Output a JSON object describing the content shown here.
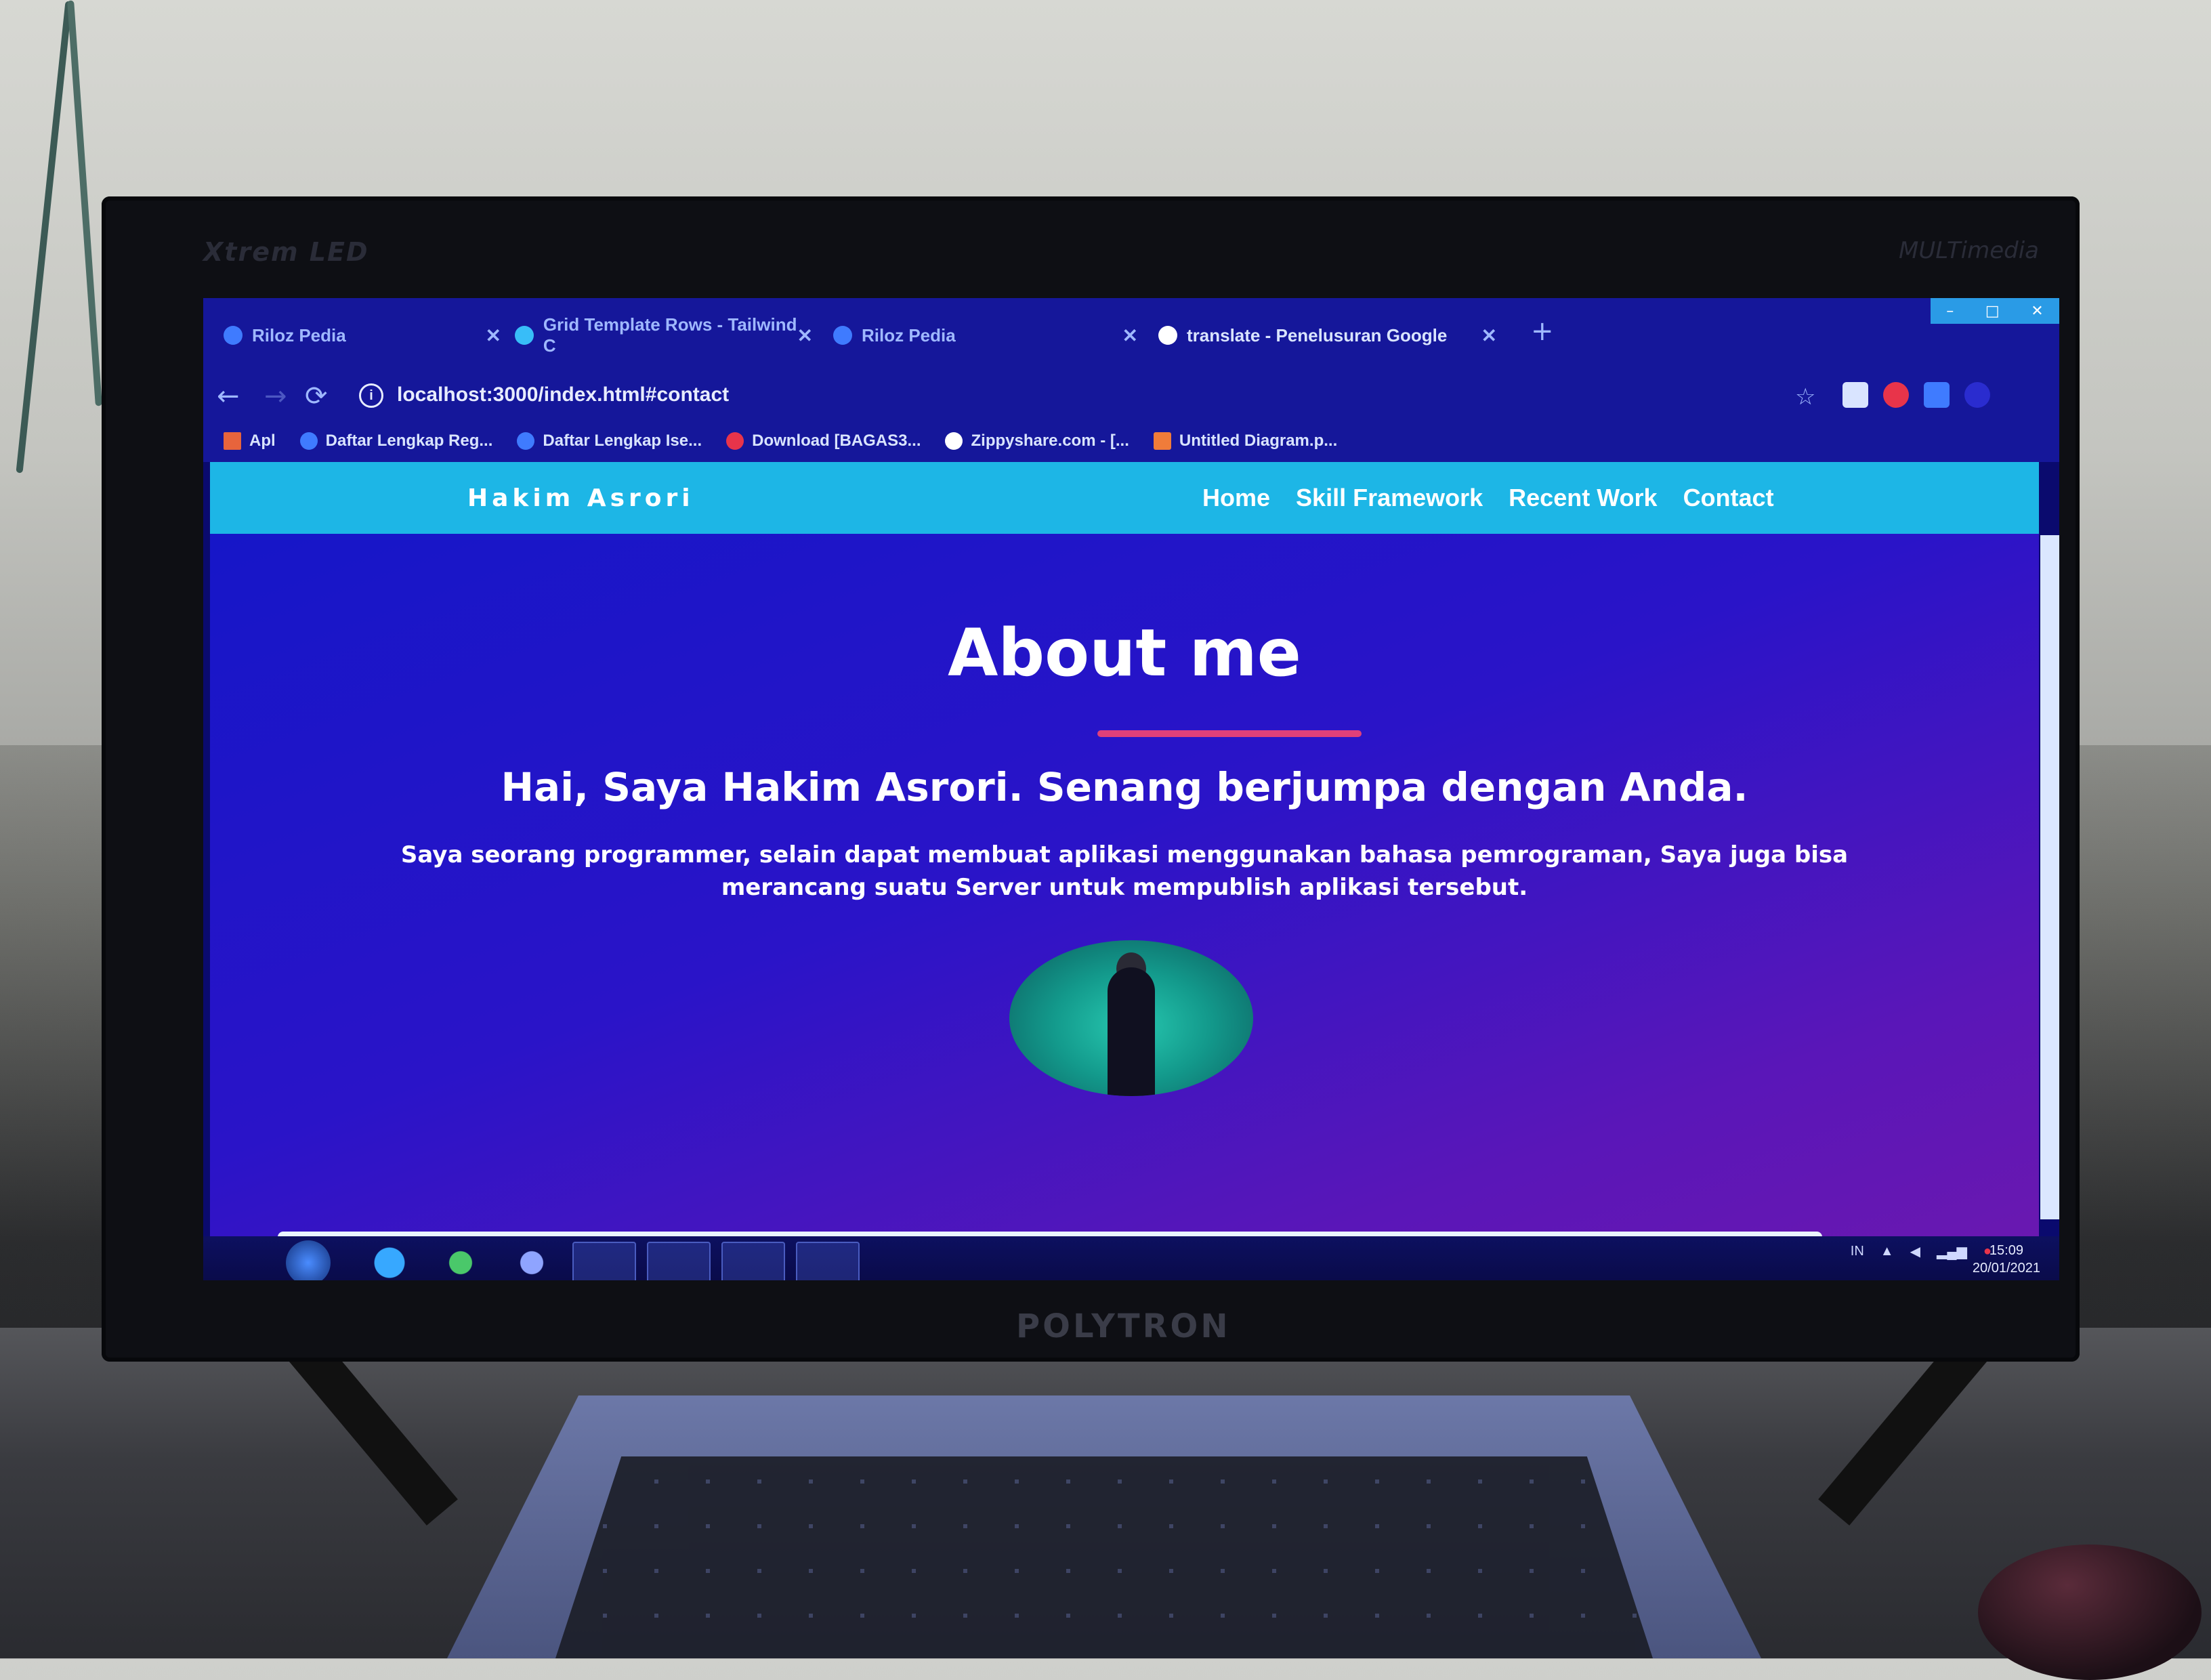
{
  "monitor": {
    "brand_top": "Xtrem LED",
    "brand_top_right": "MULTimedia",
    "brand_bottom": "POLYTRON"
  },
  "browser": {
    "tabs": [
      {
        "label": "Riloz Pedia",
        "active": false
      },
      {
        "label": "Grid Template Rows - Tailwind C",
        "active": false
      },
      {
        "label": "Riloz Pedia",
        "active": false
      },
      {
        "label": "translate - Penelusuran Google",
        "active": true
      }
    ],
    "new_tab_symbol": "+",
    "url": "localhost:3000/index.html#contact",
    "bookmarks": [
      "Apl",
      "Daftar Lengkap Reg...",
      "Daftar Lengkap Ise...",
      "Download [BAGAS3...",
      "Zippyshare.com - [...",
      "Untitled Diagram.p..."
    ]
  },
  "site": {
    "brand": "Hakim Asrori",
    "nav": [
      "Home",
      "Skill Framework",
      "Recent Work",
      "Contact"
    ],
    "heading": "About me",
    "greeting": "Hai, Saya Hakim Asrori. Senang berjumpa dengan Anda.",
    "description": "Saya seorang programmer, selain dapat membuat aplikasi menggunakan bahasa pemrograman, Saya juga bisa merancang suatu Server untuk mempublish aplikasi tersebut."
  },
  "taskbar": {
    "language": "IN",
    "time": "15:09",
    "date": "20/01/2021"
  },
  "colors": {
    "site_nav": "#1db6e6",
    "page_bg_start": "#1616c8",
    "page_bg_end": "#6a18b0",
    "underline": "#e0407a"
  }
}
